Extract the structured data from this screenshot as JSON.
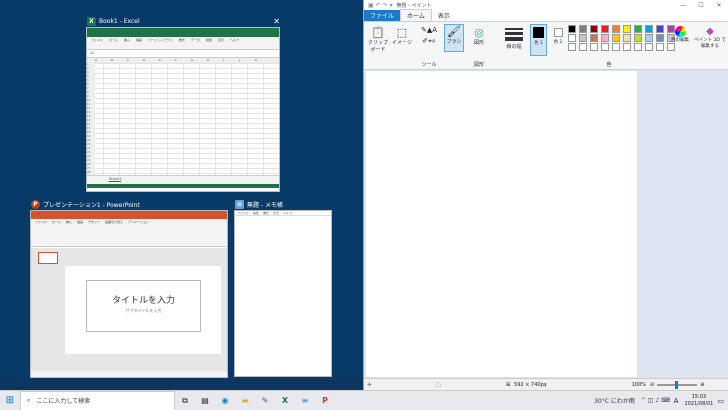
{
  "excel": {
    "title": "Book1 - Excel",
    "close": "✕",
    "sheet_tab": "Sheet1",
    "menu": [
      "ファイル",
      "ホーム",
      "挿入",
      "描画",
      "ページ レイアウト",
      "数式",
      "データ",
      "校閲",
      "表示",
      "ヘルプ"
    ],
    "cols": [
      "A",
      "B",
      "C",
      "D",
      "E",
      "F",
      "G",
      "H",
      "I",
      "J",
      "K"
    ],
    "rows": [
      "1",
      "2",
      "3",
      "4",
      "5",
      "6",
      "7",
      "8",
      "9",
      "10",
      "11",
      "12",
      "13",
      "14",
      "15",
      "16",
      "17",
      "18",
      "19",
      "20",
      "21",
      "22",
      "23",
      "24",
      "25",
      "26",
      "27",
      "28"
    ]
  },
  "powerpoint": {
    "title": "プレゼンテーション1 - PowerPoint",
    "menu": [
      "ファイル",
      "ホーム",
      "挿入",
      "描画",
      "デザイン",
      "画面切り替え",
      "アニメーション",
      "スライド ショー",
      "校閲",
      "表示"
    ],
    "slide_title": "タイトルを入力",
    "slide_subtitle": "サブタイトルを入力"
  },
  "notepad": {
    "title": "無題 - メモ帳",
    "menu": [
      "ファイル",
      "編集",
      "書式",
      "表示",
      "ヘルプ"
    ]
  },
  "paint": {
    "title": "無題 - ペイント",
    "tabs": [
      "ファイル",
      "ホーム",
      "表示"
    ],
    "groups": {
      "clipboard": "クリップボード",
      "image": "イメージ",
      "tools": "ツール",
      "brush": "ブラシ",
      "shapes": "図形",
      "line_width": "線の幅",
      "color1": "色 1",
      "color2": "色 2",
      "colors": "色",
      "edit_colors": "色の編集",
      "paint3d": "ペイント 3D で編集する",
      "group_tools": "ツール",
      "group_shapes": "図形",
      "group_colors": "色"
    },
    "palette": [
      "#000000",
      "#7f7f7f",
      "#880015",
      "#ed1c24",
      "#ff7f27",
      "#fff200",
      "#22b14c",
      "#00a2e8",
      "#3f48cc",
      "#a349a4",
      "#ffffff",
      "#c3c3c3",
      "#b97a57",
      "#ffaec9",
      "#ffc90e",
      "#efe4b0",
      "#b5e61d",
      "#99d9ea",
      "#7092be",
      "#c8bfe7",
      "#ffffff",
      "#ffffff",
      "#ffffff",
      "#ffffff",
      "#ffffff",
      "#ffffff",
      "#ffffff",
      "#ffffff",
      "#ffffff",
      "#ffffff"
    ],
    "canvas_size": "592 × 740px",
    "zoom": "100%"
  },
  "taskbar": {
    "search_placeholder": "ここに入力して検索",
    "weather": "30°C にわか雨",
    "time": "15:03",
    "date": "2021/08/01",
    "lang": "A"
  }
}
